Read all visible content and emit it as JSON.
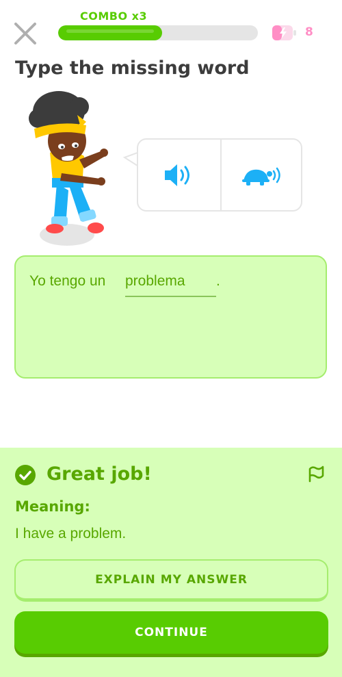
{
  "header": {
    "combo_label": "COMBO x3",
    "progress_fraction": 0.52,
    "energy_count": "8"
  },
  "exercise": {
    "title": "Type the missing word",
    "sentence_prefix": "Yo tengo un",
    "answer_word": "problema",
    "sentence_suffix": "."
  },
  "feedback": {
    "title": "Great job!",
    "meaning_label": "Meaning:",
    "meaning_text": "I have a problem.",
    "explain_label": "EXPLAIN MY ANSWER",
    "continue_label": "CONTINUE"
  },
  "colors": {
    "accent_green": "#58cc02",
    "feedback_bg": "#d7ffb8",
    "feedback_text": "#58a700",
    "audio_blue": "#1cb0f6",
    "energy_pink": "#ff8ec5"
  },
  "icons": {
    "close": "close-icon",
    "energy": "energy-battery-icon",
    "audio": "speaker-icon",
    "slow_audio": "turtle-speaker-icon",
    "success": "check-circle-icon",
    "report": "flag-icon"
  }
}
